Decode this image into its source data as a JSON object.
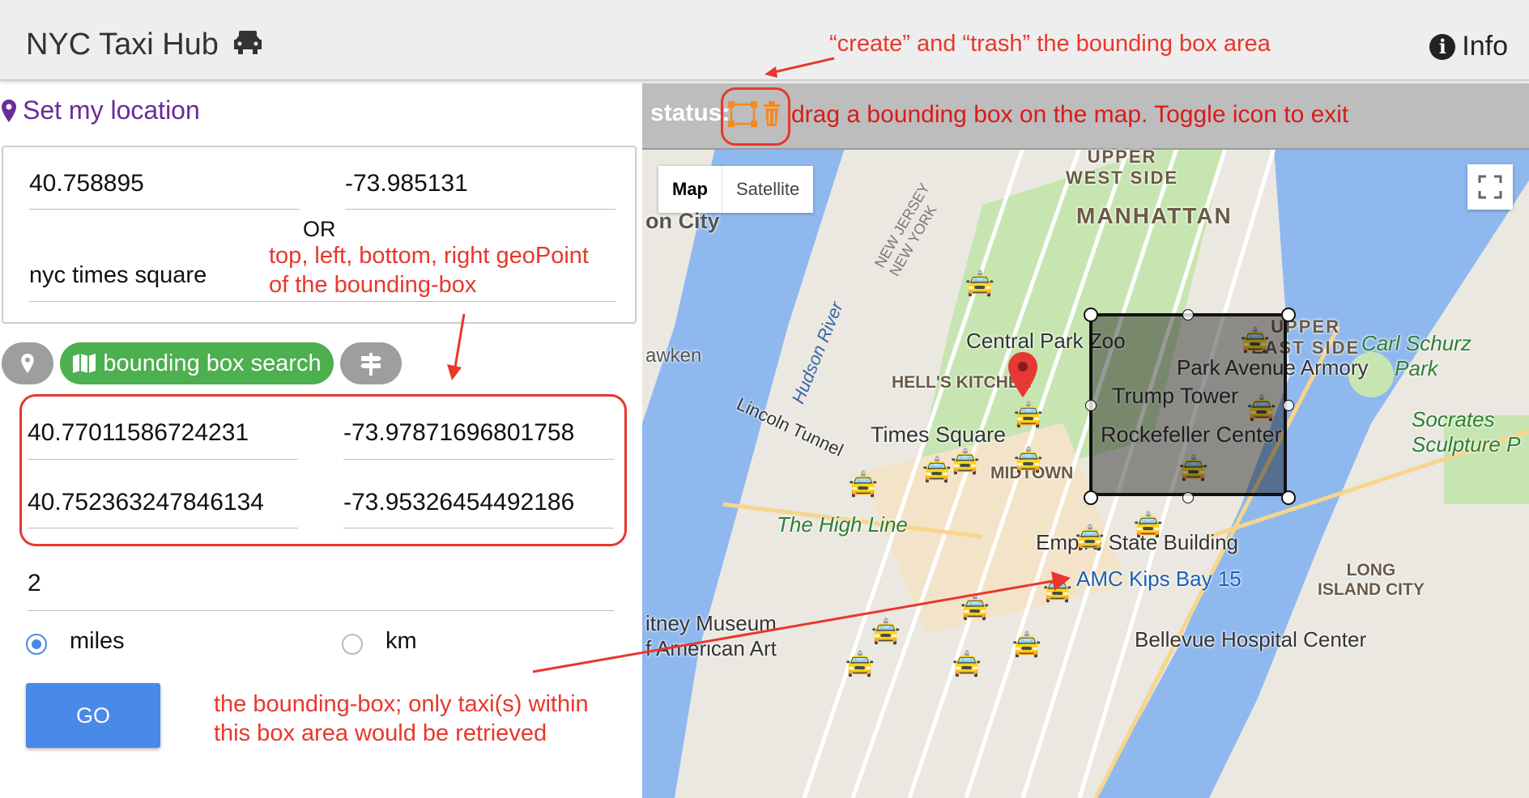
{
  "header": {
    "title": "NYC Taxi Hub",
    "info_label": "Info"
  },
  "location": {
    "link_label": "Set my location"
  },
  "coords": {
    "lat": "40.758895",
    "lng": "-73.985131",
    "or_label": "OR",
    "address": "nyc times square"
  },
  "annotations": {
    "geopoint_line1": "top, left, bottom, right geoPoint",
    "geopoint_line2": "of the bounding-box",
    "create_trash": "“create” and “trash” the bounding box area",
    "bbox_line1": "the bounding-box; only taxi(s) within",
    "bbox_line2": "this box area would be retrieved"
  },
  "search_modes": {
    "bbox_label": "bounding box search"
  },
  "bbox": {
    "top": "40.77011586724231",
    "left": "-73.97871696801758",
    "bottom": "40.752363247846134",
    "right": "-73.95326454492186"
  },
  "distance": {
    "value": "2",
    "unit_miles": "miles",
    "unit_km": "km",
    "selected": "miles"
  },
  "go_label": "GO",
  "map": {
    "status_label": "status:",
    "status_message": "drag a bounding box on the map. Toggle icon to exit",
    "type_map": "Map",
    "type_satellite": "Satellite",
    "labels": {
      "upper_west_side_1": "UPPER",
      "upper_west_side_2": "WEST SIDE",
      "manhattan": "MANHATTAN",
      "upper_east_side_1": "UPPER",
      "upper_east_side_2": "EAST SIDE",
      "carl_schurz_1": "Carl Schurz",
      "carl_schurz_2": "Park",
      "central_park_zoo": "Central Park Zoo",
      "park_avenue_armory": "Park Avenue Armory",
      "hells_kitchen": "HELL'S KITCHEN",
      "trump_tower": "Trump Tower",
      "times_square": "Times Square",
      "rockefeller_center": "Rockefeller Center",
      "midtown": "MIDTOWN",
      "high_line": "The High Line",
      "empire_state": "Empire State Building",
      "amc_kips_bay": "AMC Kips Bay 15",
      "bellevue": "Bellevue Hospital Center",
      "long_island_city_1": "LONG",
      "long_island_city_2": "ISLAND CITY",
      "socrates_1": "Socrates",
      "socrates_2": "Sculpture P",
      "union_city": "on City",
      "weehawken": "awken",
      "lincoln_tunnel": "Lincoln Tunnel",
      "hudson_river": "Hudson River",
      "museum_1": "itney Museum",
      "museum_2": "f American Art",
      "nj_ny_1": "NEW JERSEY",
      "nj_ny_2": "NEW YORK"
    }
  },
  "colors": {
    "accent_green": "#4caf50",
    "accent_blue": "#4a89e8",
    "annotation_red": "#e8372c",
    "icon_orange": "#f5891f"
  }
}
